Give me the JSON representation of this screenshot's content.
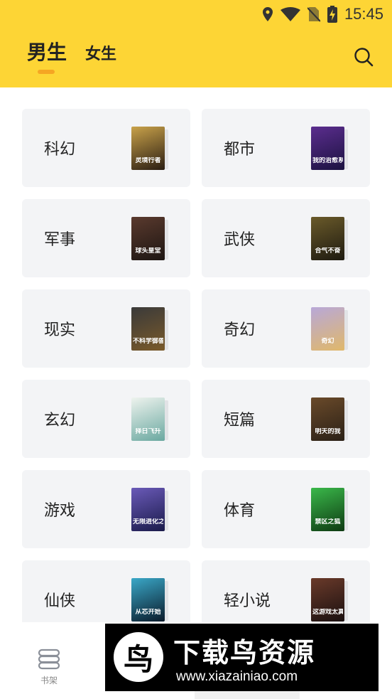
{
  "status_bar": {
    "time": "15:45"
  },
  "header": {
    "tabs": [
      {
        "label": "男生",
        "active": true
      },
      {
        "label": "女生",
        "active": false
      }
    ],
    "search_icon": "search-icon",
    "background": "#fdd535",
    "indicator_color": "#f5a623"
  },
  "categories": [
    {
      "label": "科幻",
      "cover_title": "灵境行者",
      "cover_colors": [
        "#c9a24a",
        "#2a1d12"
      ]
    },
    {
      "label": "都市",
      "cover_title": "我的治愈系游戏",
      "cover_colors": [
        "#5b2d8e",
        "#1b1240"
      ]
    },
    {
      "label": "军事",
      "cover_title": "球头皇堂",
      "cover_colors": [
        "#5a3a2e",
        "#1d1512"
      ]
    },
    {
      "label": "武侠",
      "cover_title": "合气不奋",
      "cover_colors": [
        "#6a5a2a",
        "#1e1a10"
      ]
    },
    {
      "label": "现实",
      "cover_title": "不科学御兽",
      "cover_colors": [
        "#3a3a3a",
        "#7a5a2a"
      ]
    },
    {
      "label": "奇幻",
      "cover_title": "奇幻",
      "cover_colors": [
        "#b8a8d8",
        "#e0b86a"
      ]
    },
    {
      "label": "玄幻",
      "cover_title": "择日飞升",
      "cover_colors": [
        "#eef3ee",
        "#6aa8a0"
      ]
    },
    {
      "label": "短篇",
      "cover_title": "明天的我",
      "cover_colors": [
        "#6a4a2a",
        "#2a2016"
      ]
    },
    {
      "label": "游戏",
      "cover_title": "无限进化之元宇宙",
      "cover_colors": [
        "#6a5ab8",
        "#1a1a4a"
      ]
    },
    {
      "label": "体育",
      "cover_title": "禁区之狐",
      "cover_colors": [
        "#3ab84a",
        "#0e3a12"
      ]
    },
    {
      "label": "仙侠",
      "cover_title": "从芯开始",
      "cover_colors": [
        "#3aa8c8",
        "#0a1a2a"
      ]
    },
    {
      "label": "轻小说",
      "cover_title": "这游戏太真实了",
      "cover_colors": [
        "#6a3a2a",
        "#1a1010"
      ]
    }
  ],
  "bottom_nav": {
    "shelf_label": "书架",
    "shelf_icon": "book-shelf-icon"
  },
  "watermark": {
    "logo_glyph": "鸟",
    "title": "下载鸟资源",
    "url": "www.xiazainiao.com"
  }
}
